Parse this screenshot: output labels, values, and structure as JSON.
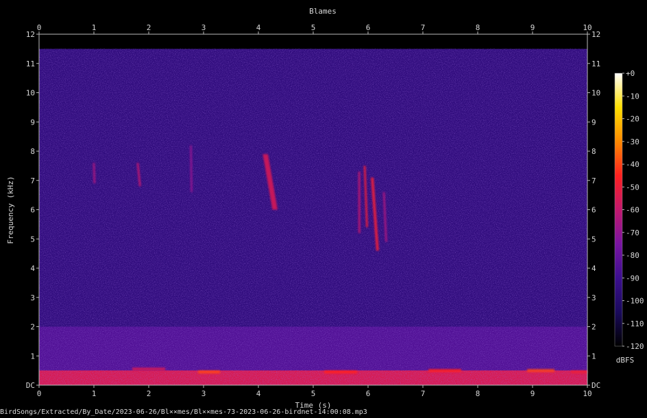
{
  "chart_data": {
    "type": "heatmap",
    "title": "Blames",
    "xlabel": "Time (s)",
    "ylabel": "Frequency (kHz)",
    "xlim": [
      0,
      10
    ],
    "ylim": [
      0,
      12
    ],
    "x_ticks": [
      "0",
      "1",
      "2",
      "3",
      "4",
      "5",
      "6",
      "7",
      "8",
      "9",
      "10"
    ],
    "y_ticks": [
      "DC",
      "1",
      "2",
      "3",
      "4",
      "5",
      "6",
      "7",
      "8",
      "9",
      "10",
      "11",
      "12"
    ],
    "colorbar": {
      "label": "dBFS",
      "range": [
        -120,
        0
      ],
      "ticks": [
        "+0",
        "-10",
        "-20",
        "-30",
        "-40",
        "-50",
        "-60",
        "-70",
        "-80",
        "-90",
        "-100",
        "-110",
        "-120"
      ],
      "colors": [
        "#000000",
        "#1a0a5c",
        "#3c0f8f",
        "#7a14a3",
        "#c2186e",
        "#ff2020",
        "#ff8a00",
        "#ffe000",
        "#ffffff"
      ]
    },
    "background_energy": [
      {
        "f_low": 0,
        "f_high": 0.5,
        "level_dbfs": -55
      },
      {
        "f_low": 0.5,
        "f_high": 2,
        "level_dbfs": -85
      },
      {
        "f_low": 2,
        "f_high": 11.5,
        "level_dbfs": -95
      },
      {
        "f_low": 11.5,
        "f_high": 12,
        "level_dbfs": -120
      }
    ],
    "events": [
      {
        "t_start": 0.98,
        "t_end": 1.03,
        "f_high": 7.6,
        "f_low": 6.9,
        "level_dbfs": -65
      },
      {
        "t_start": 1.78,
        "t_end": 1.86,
        "f_high": 7.6,
        "f_low": 6.8,
        "level_dbfs": -60
      },
      {
        "t_start": 2.75,
        "t_end": 2.8,
        "f_high": 8.2,
        "f_low": 6.6,
        "level_dbfs": -70
      },
      {
        "t_start": 4.08,
        "t_end": 4.35,
        "f_high": 7.9,
        "f_low": 6.0,
        "level_dbfs": -55
      },
      {
        "t_start": 5.82,
        "t_end": 5.86,
        "f_high": 7.3,
        "f_low": 5.2,
        "level_dbfs": -60
      },
      {
        "t_start": 5.92,
        "t_end": 6.0,
        "f_high": 7.5,
        "f_low": 5.4,
        "level_dbfs": -50
      },
      {
        "t_start": 6.05,
        "t_end": 6.2,
        "f_high": 7.1,
        "f_low": 4.6,
        "level_dbfs": -50
      },
      {
        "t_start": 6.27,
        "t_end": 6.35,
        "f_high": 6.6,
        "f_low": 4.9,
        "level_dbfs": -65
      },
      {
        "t_start": 1.7,
        "t_end": 2.3,
        "f_high": 0.6,
        "f_low": 0.5,
        "level_dbfs": -55
      },
      {
        "t_start": 2.9,
        "t_end": 3.3,
        "f_high": 0.5,
        "f_low": 0.4,
        "level_dbfs": -40
      },
      {
        "t_start": 5.2,
        "t_end": 5.8,
        "f_high": 0.5,
        "f_low": 0.4,
        "level_dbfs": -45
      },
      {
        "t_start": 7.1,
        "t_end": 7.7,
        "f_high": 0.55,
        "f_low": 0.45,
        "level_dbfs": -45
      },
      {
        "t_start": 8.9,
        "t_end": 9.4,
        "f_high": 0.55,
        "f_low": 0.45,
        "level_dbfs": -40
      },
      {
        "t_start": 9.7,
        "t_end": 10.0,
        "f_high": 0.5,
        "f_low": 0.4,
        "level_dbfs": -50
      }
    ],
    "grid": false
  },
  "footer": {
    "path": "BirdSongs/Extracted/By_Date/2023-06-26/Bl××mes/Bl××mes-73-2023-06-26-birdnet-14:00:08.mp3"
  }
}
